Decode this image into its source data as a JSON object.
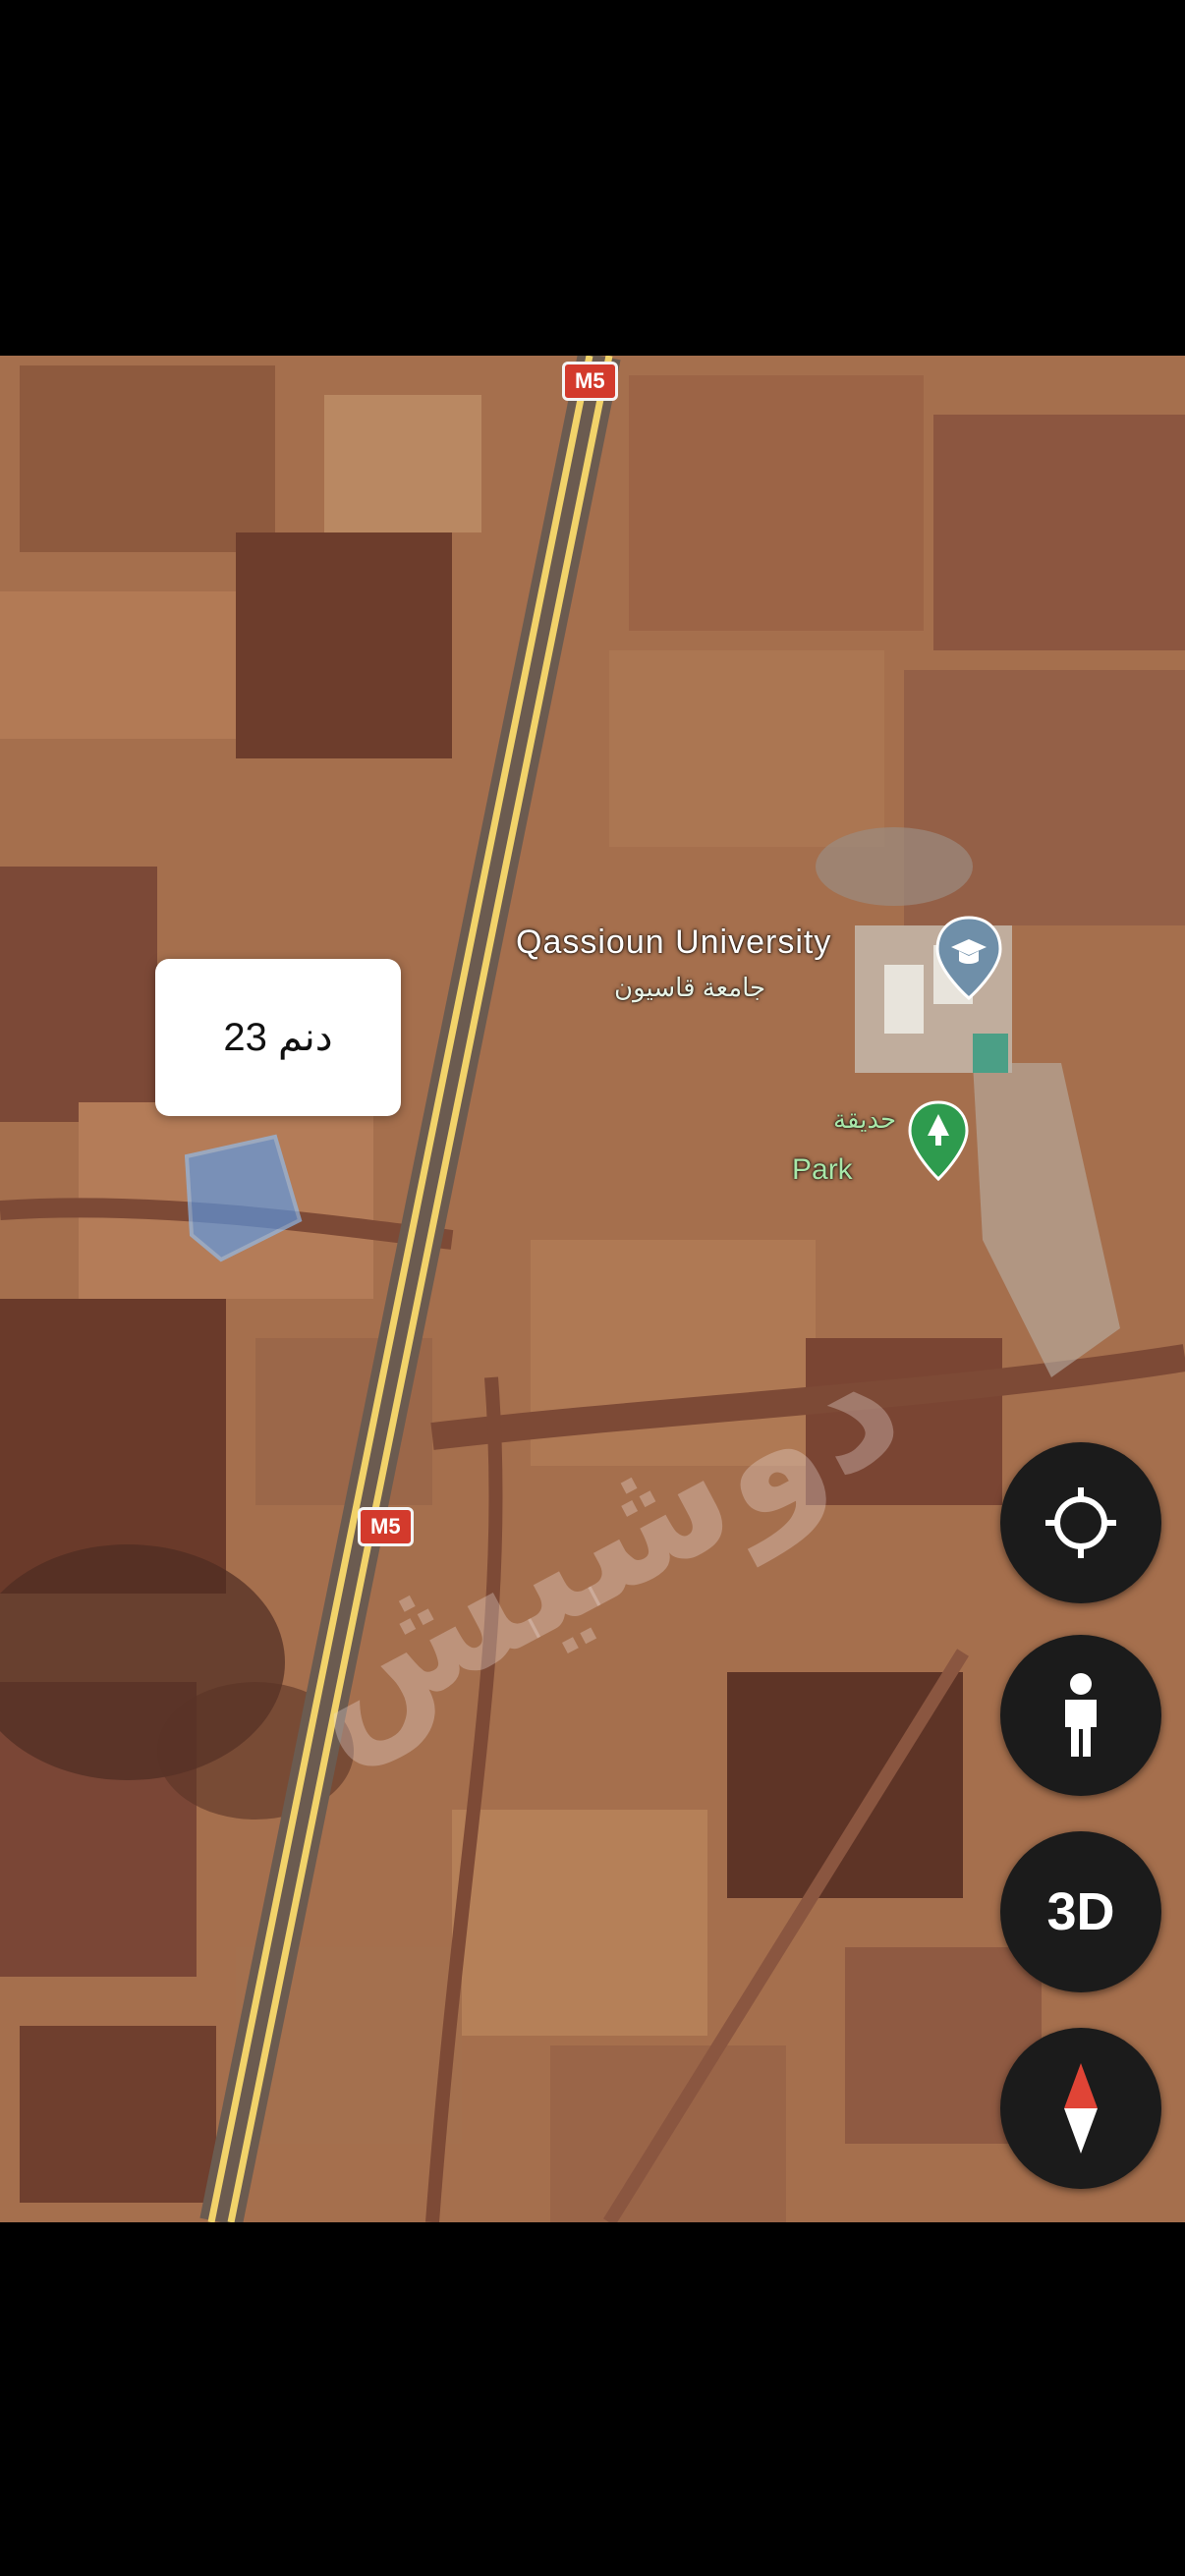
{
  "map": {
    "route_shield_top": "M5",
    "route_shield_mid": "M5",
    "poi_university_en": "Qassioun University",
    "poi_university_ar": "جامعة قاسيون",
    "poi_park_ar": "حديقة",
    "poi_park_en": "Park",
    "parcel_label": "23 دنم",
    "watermark_text": "دوشيش",
    "university_icon": "graduation-cap-icon",
    "park_icon": "tree-pin-icon",
    "parcel_color": "#5b9bea"
  },
  "controls": {
    "location_icon": "my-location-icon",
    "streetview_icon": "pegman-icon",
    "view_3d_label": "3D",
    "compass_icon": "compass-icon"
  }
}
